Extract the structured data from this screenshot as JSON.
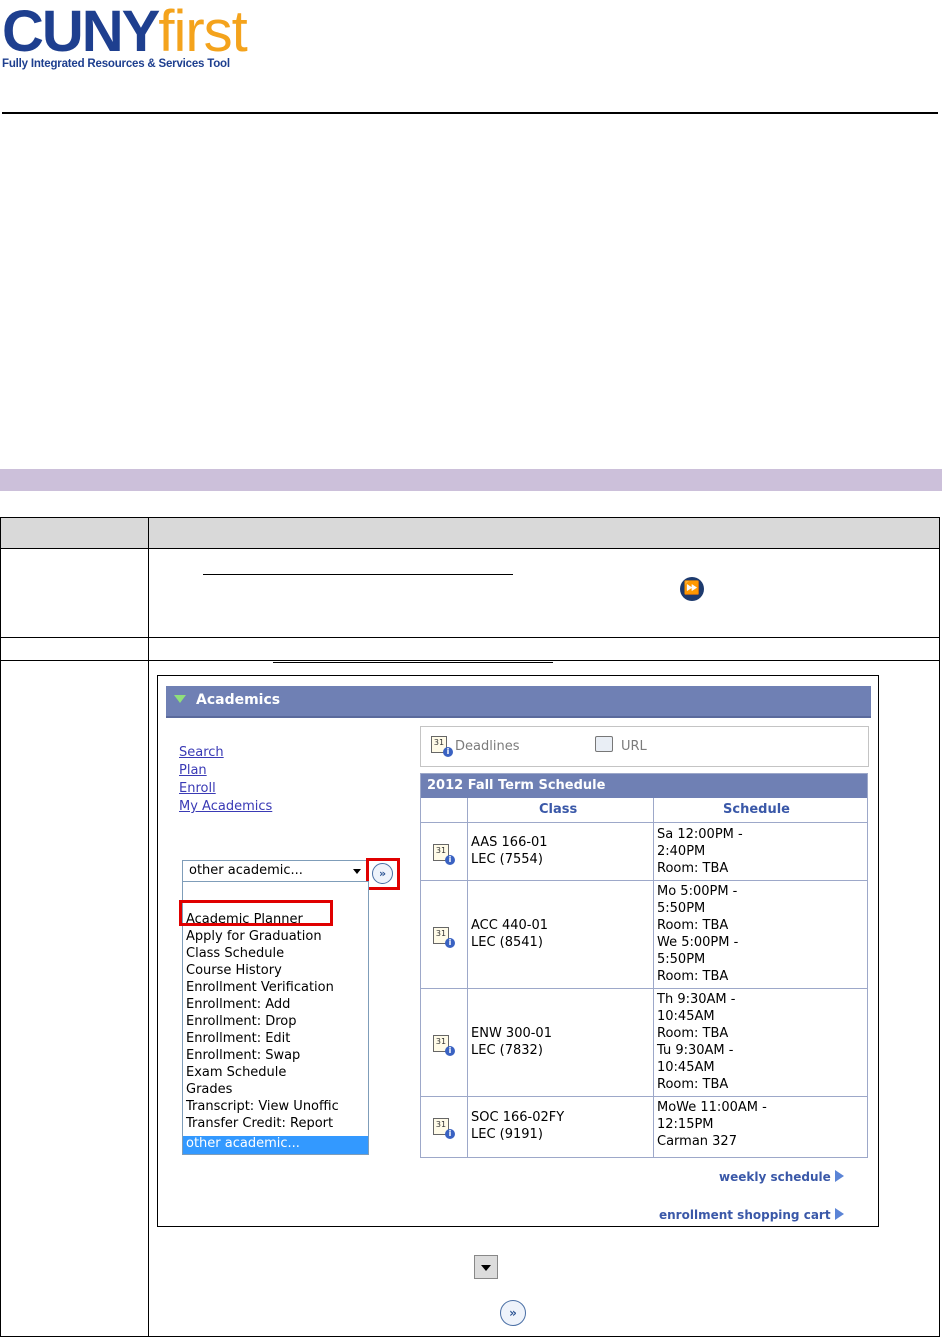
{
  "logo": {
    "brand_primary": "CUNY",
    "brand_secondary": "first",
    "tagline": "Fully Integrated Resources & Services Tool",
    "primary_color": "#1e3f8f",
    "secondary_color": "#f4a31c"
  },
  "section_band_color": "#ccc0da",
  "academics": {
    "panel_title": "Academics",
    "links": [
      "Search",
      "Plan",
      "Enroll",
      "My Academics"
    ],
    "dropdown": {
      "selected": "other academic...",
      "options": [
        "Academic Planner",
        "Apply for Graduation",
        "Class Schedule",
        "Course History",
        "Enrollment Verification",
        "Enrollment: Add",
        "Enrollment: Drop",
        "Enrollment: Edit",
        "Enrollment: Swap",
        "Exam Schedule",
        "Grades",
        "Transcript: View Unoffic",
        "Transfer Credit: Report",
        "other academic..."
      ],
      "highlighted": "Academic Planner"
    },
    "info_links": {
      "deadlines": "Deadlines",
      "url": "URL"
    },
    "schedule": {
      "caption": "2012 Fall Term Schedule",
      "col_class": "Class",
      "col_schedule": "Schedule",
      "rows": [
        {
          "class": [
            "AAS 166-01",
            "LEC (7554)"
          ],
          "schedule": [
            "Sa 12:00PM -",
            "2:40PM",
            "Room:  TBA"
          ]
        },
        {
          "class": [
            "ACC 440-01",
            "LEC (8541)"
          ],
          "schedule": [
            "Mo 5:00PM -",
            "5:50PM",
            "Room:  TBA",
            "We 5:00PM -",
            "5:50PM",
            "Room:  TBA"
          ]
        },
        {
          "class": [
            "ENW 300-01",
            "LEC (7832)"
          ],
          "schedule": [
            "Th 9:30AM -",
            "10:45AM",
            "Room:  TBA",
            "Tu 9:30AM -",
            "10:45AM",
            "Room:  TBA"
          ]
        },
        {
          "class": [
            "SOC 166-02FY",
            "LEC (9191)"
          ],
          "schedule": [
            "MoWe 11:00AM -",
            "12:15PM",
            "Carman 327"
          ]
        }
      ]
    },
    "footer_links": {
      "weekly": "weekly schedule",
      "cart": "enrollment shopping cart"
    }
  }
}
